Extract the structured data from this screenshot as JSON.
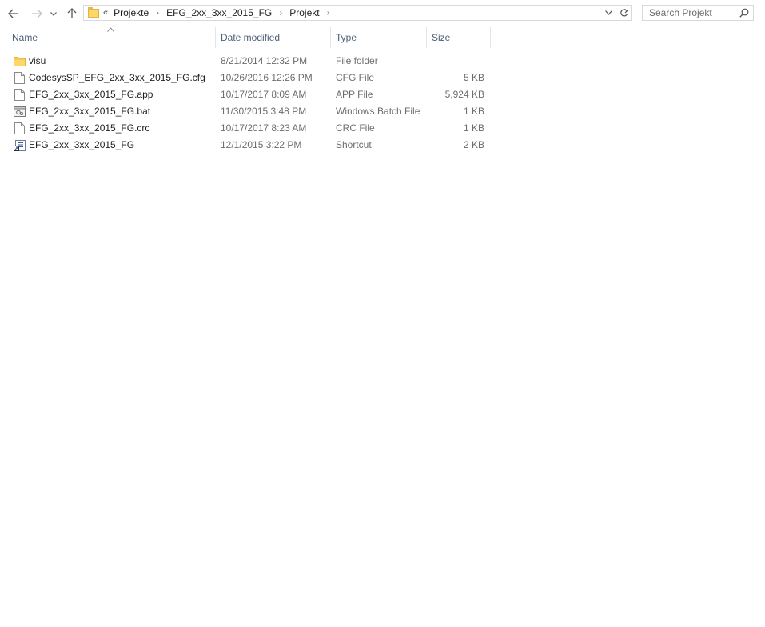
{
  "navigation": {
    "back_icon": "arrow-left-icon",
    "forward_icon": "arrow-right-icon",
    "recent_icon": "chevron-down-icon",
    "up_icon": "arrow-up-icon"
  },
  "address_bar": {
    "overflow": "«",
    "breadcrumbs": [
      "Projekte",
      "EFG_2xx_3xx_2015_FG",
      "Projekt"
    ],
    "separator": "›"
  },
  "search": {
    "placeholder": "Search Projekt"
  },
  "columns": {
    "name": "Name",
    "date_modified": "Date modified",
    "type": "Type",
    "size": "Size"
  },
  "files": [
    {
      "name": "visu",
      "date": "8/21/2014 12:32 PM",
      "type": "File folder",
      "size": "",
      "icon": "folder-icon"
    },
    {
      "name": "CodesysSP_EFG_2xx_3xx_2015_FG.cfg",
      "date": "10/26/2016 12:26 PM",
      "type": "CFG File",
      "size": "5 KB",
      "icon": "file-icon"
    },
    {
      "name": "EFG_2xx_3xx_2015_FG.app",
      "date": "10/17/2017 8:09 AM",
      "type": "APP File",
      "size": "5,924 KB",
      "icon": "file-icon"
    },
    {
      "name": "EFG_2xx_3xx_2015_FG.bat",
      "date": "11/30/2015 3:48 PM",
      "type": "Windows Batch File",
      "size": "1 KB",
      "icon": "batch-file-icon"
    },
    {
      "name": "EFG_2xx_3xx_2015_FG.crc",
      "date": "10/17/2017 8:23 AM",
      "type": "CRC File",
      "size": "1 KB",
      "icon": "file-icon"
    },
    {
      "name": "EFG_2xx_3xx_2015_FG",
      "date": "12/1/2015 3:22 PM",
      "type": "Shortcut",
      "size": "2 KB",
      "icon": "shortcut-icon"
    }
  ],
  "colors": {
    "header_text": "#4c607a",
    "secondary_text": "#6d6d6d",
    "folder_yellow": "#ffd766"
  }
}
